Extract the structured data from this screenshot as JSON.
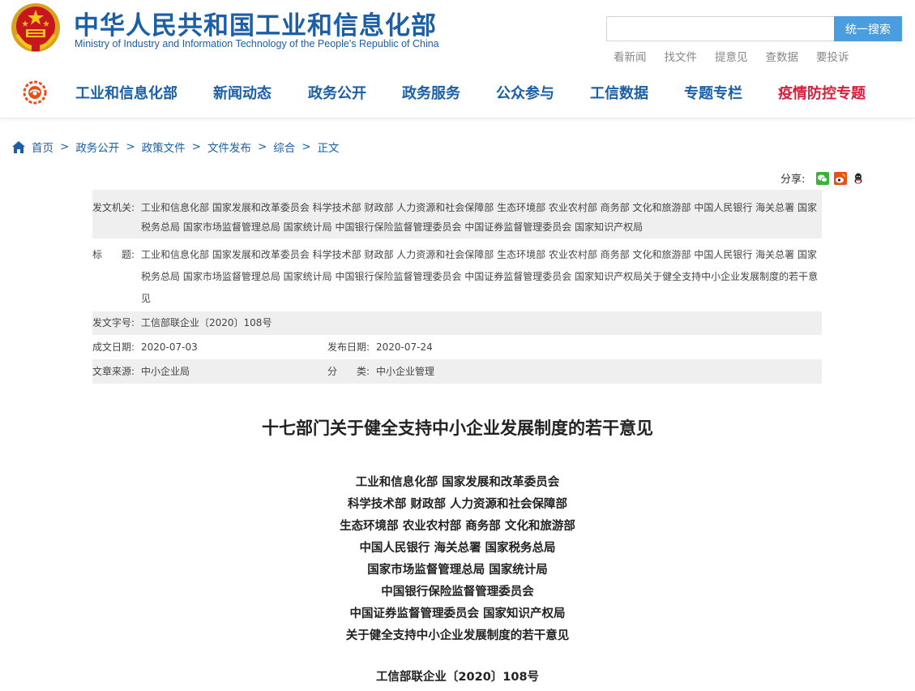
{
  "header": {
    "title": "中华人民共和国工业和信息化部",
    "subtitle": "Ministry of Industry and Information Technology of the People's Republic of China",
    "search": {
      "placeholder": "",
      "button_label": "统一搜索"
    },
    "quick_links": [
      "看新闻",
      "找文件",
      "提意见",
      "查数据",
      "要投诉"
    ]
  },
  "nav": {
    "items": [
      "工业和信息化部",
      "新闻动态",
      "政务公开",
      "政务服务",
      "公众参与",
      "工信数据",
      "专题专栏",
      "疫情防控专题"
    ],
    "highlight_color": "#d81e3a"
  },
  "breadcrumb": {
    "items": [
      "首页",
      "政务公开",
      "政策文件",
      "文件发布",
      "综合",
      "正文"
    ],
    "separator": ">"
  },
  "share": {
    "label": "分享:"
  },
  "meta": {
    "issuer_label": "发文机关:",
    "issuer_value": "工业和信息化部 国家发展和改革委员会 科学技术部 财政部 人力资源和社会保障部 生态环境部 农业农村部 商务部 文化和旅游部 中国人民银行 海关总署 国家税务总局 国家市场监督管理总局 国家统计局 中国银行保险监督管理委员会 中国证券监督管理委员会 国家知识产权局",
    "title_label": "标　　题:",
    "title_value": "工业和信息化部 国家发展和改革委员会 科学技术部 财政部 人力资源和社会保障部 生态环境部 农业农村部 商务部 文化和旅游部 中国人民银行 海关总署 国家税务总局 国家市场监督管理总局 国家统计局 中国银行保险监督管理委员会 中国证券监督管理委员会 国家知识产权局关于健全支持中小企业发展制度的若干意见",
    "docno_label": "发文字号:",
    "docno_value": "工信部联企业〔2020〕108号",
    "created_label": "成文日期:",
    "created_value": "2020-07-03",
    "published_label": "发布日期:",
    "published_value": "2020-07-24",
    "source_label": "文章来源:",
    "source_value": "中小企业局",
    "category_label": "分　　类:",
    "category_value": "中小企业管理"
  },
  "article": {
    "title": "十七部门关于健全支持中小企业发展制度的若干意见",
    "issuer_lines": [
      "工业和信息化部 国家发展和改革委员会",
      "科学技术部 财政部 人力资源和社会保障部",
      "生态环境部 农业农村部 商务部 文化和旅游部",
      "中国人民银行 海关总署 国家税务总局",
      "国家市场监督管理总局  国家统计局",
      "中国银行保险监督管理委员会",
      "中国证券监督管理委员会 国家知识产权局",
      "关于健全支持中小企业发展制度的若干意见"
    ],
    "doc_number": "工信部联企业〔2020〕108号"
  }
}
